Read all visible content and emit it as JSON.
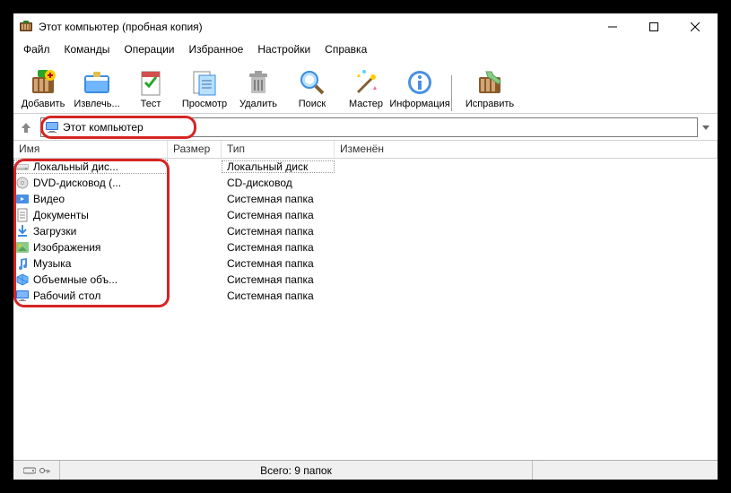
{
  "window": {
    "title": "Этот компьютер (пробная копия)"
  },
  "menu": {
    "items": [
      "Файл",
      "Команды",
      "Операции",
      "Избранное",
      "Настройки",
      "Справка"
    ]
  },
  "toolbar": {
    "items": [
      {
        "label": "Добавить",
        "icon": "add"
      },
      {
        "label": "Извлечь...",
        "icon": "extract"
      },
      {
        "label": "Тест",
        "icon": "test"
      },
      {
        "label": "Просмотр",
        "icon": "view"
      },
      {
        "label": "Удалить",
        "icon": "delete"
      },
      {
        "label": "Поиск",
        "icon": "find"
      },
      {
        "label": "Мастер",
        "icon": "wizard"
      },
      {
        "label": "Информация",
        "icon": "info"
      }
    ],
    "items2": [
      {
        "label": "Исправить",
        "icon": "repair"
      }
    ]
  },
  "address": {
    "text": "Этот компьютер"
  },
  "columns": {
    "name": "Имя",
    "size": "Размер",
    "type": "Тип",
    "modified": "Изменён"
  },
  "rows": [
    {
      "name": "Локальный дис...",
      "type": "Локальный диск",
      "icon": "drive"
    },
    {
      "name": "DVD-дисковод (...",
      "type": "CD-дисковод",
      "icon": "cd"
    },
    {
      "name": "Видео",
      "type": "Системная папка",
      "icon": "video"
    },
    {
      "name": "Документы",
      "type": "Системная папка",
      "icon": "doc"
    },
    {
      "name": "Загрузки",
      "type": "Системная папка",
      "icon": "download"
    },
    {
      "name": "Изображения",
      "type": "Системная папка",
      "icon": "pic"
    },
    {
      "name": "Музыка",
      "type": "Системная папка",
      "icon": "music"
    },
    {
      "name": "Объемные объ...",
      "type": "Системная папка",
      "icon": "3d"
    },
    {
      "name": "Рабочий стол",
      "type": "Системная папка",
      "icon": "desktop"
    }
  ],
  "status": {
    "center": "Всего: 9 папок"
  }
}
